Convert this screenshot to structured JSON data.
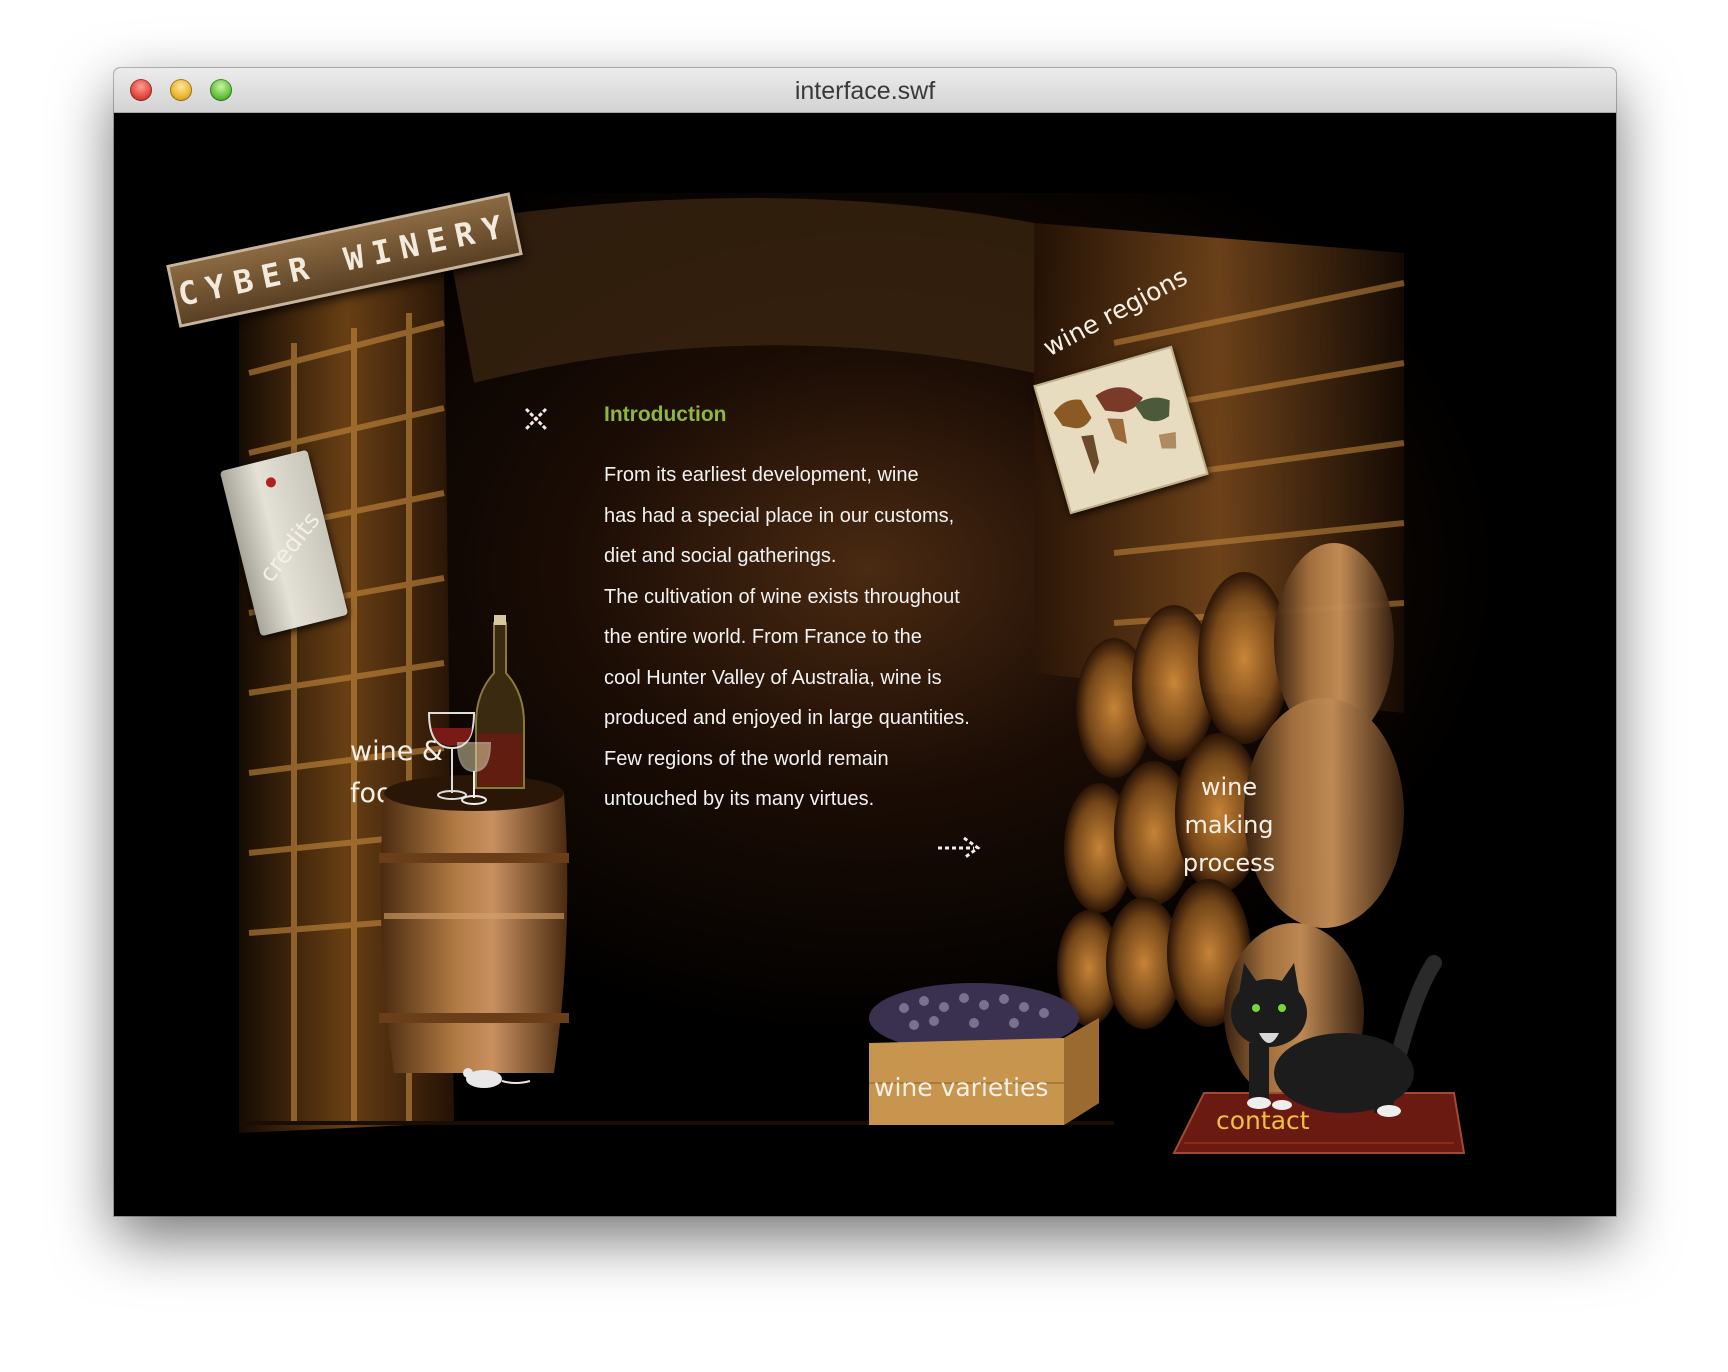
{
  "window": {
    "title": "interface.swf"
  },
  "logo": {
    "text": "CYBER WINERY"
  },
  "nav": {
    "wine_regions": "wine regions",
    "credits": "credits",
    "wine_food_line1": "wine &",
    "wine_food_line2": "food",
    "wine_making_line1": "wine",
    "wine_making_line2": "making",
    "wine_making_line3": "process",
    "wine_varieties": "wine varieties",
    "contact": "contact"
  },
  "content": {
    "title": "Introduction",
    "lines": [
      "From its earliest development, wine",
      "has had a special place in our customs,",
      "diet and social gatherings.",
      "The cultivation of wine exists throughout",
      "the entire world.  From France to the",
      "cool Hunter Valley of Australia, wine is",
      "produced and enjoyed in large quantities.",
      "Few regions of the world remain",
      "untouched by its many virtues."
    ]
  },
  "colors": {
    "accent": "#8fb83a",
    "background": "#000000",
    "wood": "#8a5a22"
  },
  "icons": {
    "close": "close-icon",
    "next": "next-arrow-icon"
  }
}
